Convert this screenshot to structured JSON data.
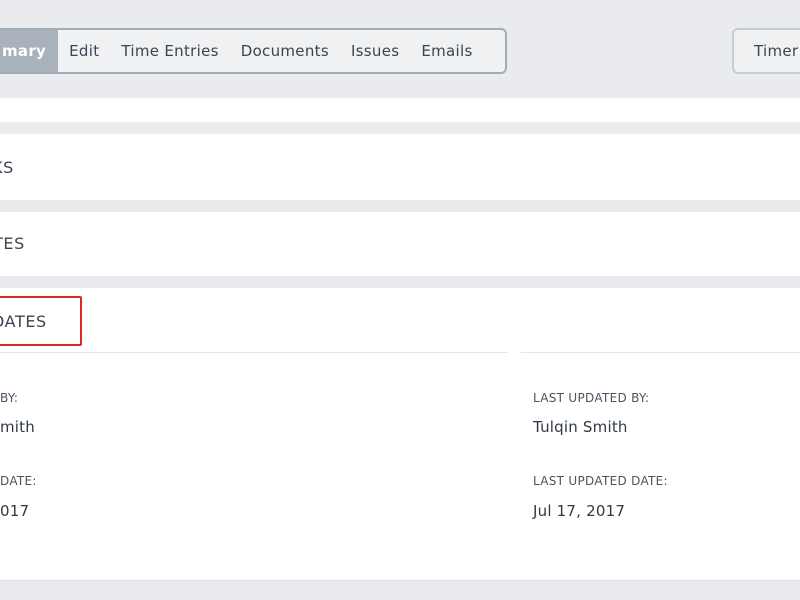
{
  "tabs": [
    {
      "label": "mary"
    },
    {
      "label": "Edit"
    },
    {
      "label": "Time Entries"
    },
    {
      "label": "Documents"
    },
    {
      "label": "Issues"
    },
    {
      "label": "Emails"
    }
  ],
  "timer_button": {
    "label": "Timer"
  },
  "sections": {
    "tasks_title": "KS",
    "notes_title": "TES",
    "dates_title": "DATES"
  },
  "dates": {
    "created_by_label": "BY:",
    "created_by_value": "mith",
    "created_date_label": "DATE:",
    "created_date_value": "017",
    "last_updated_by_label": "LAST UPDATED BY:",
    "last_updated_by_value": "Tulqin Smith",
    "last_updated_date_label": "LAST UPDATED DATE:",
    "last_updated_date_value": "Jul 17, 2017"
  },
  "colors": {
    "highlight": "#e0262a",
    "active_tab": "#a9b1bb",
    "page_bg": "#e9ebee"
  }
}
